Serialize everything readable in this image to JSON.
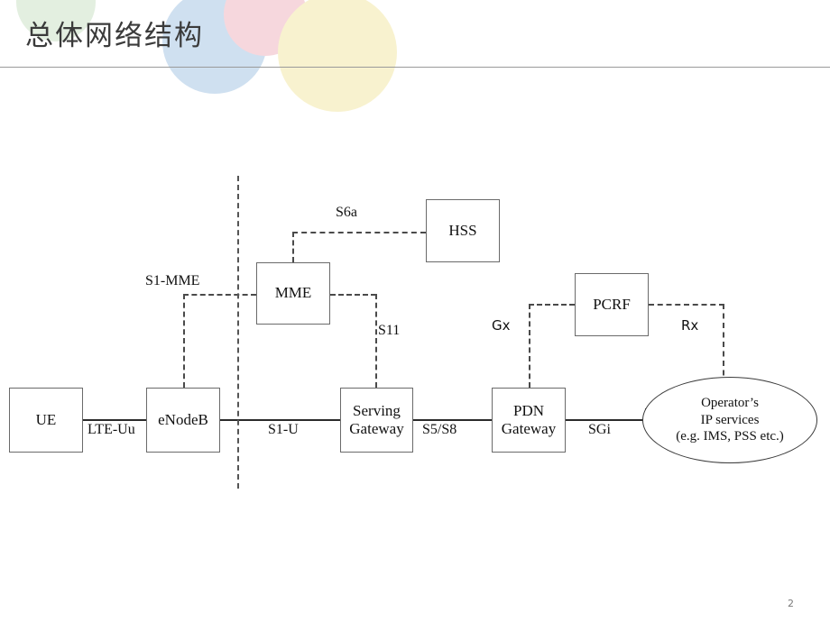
{
  "slide": {
    "title": "总体网络结构",
    "page_number": "2"
  },
  "decor": {
    "circle_green": "#e3efe0",
    "circle_blue": "#cfe0f0",
    "circle_pink": "#f6d7dd",
    "circle_yellow": "#f8f2cf",
    "rule_color": "#9a9a9a"
  },
  "diagram": {
    "type": "network-architecture",
    "nodes": [
      {
        "id": "ue",
        "label_line1": "UE",
        "label_line2": "",
        "shape": "rect"
      },
      {
        "id": "enodeb",
        "label_line1": "eNodeB",
        "label_line2": "",
        "shape": "rect"
      },
      {
        "id": "sgw",
        "label_line1": "Serving",
        "label_line2": "Gateway",
        "shape": "rect"
      },
      {
        "id": "pgw",
        "label_line1": "PDN",
        "label_line2": "Gateway",
        "shape": "rect"
      },
      {
        "id": "mme",
        "label_line1": "MME",
        "label_line2": "",
        "shape": "rect"
      },
      {
        "id": "hss",
        "label_line1": "HSS",
        "label_line2": "",
        "shape": "rect"
      },
      {
        "id": "pcrf",
        "label_line1": "PCRF",
        "label_line2": "",
        "shape": "rect"
      },
      {
        "id": "operator",
        "label_line1": "Operator’s",
        "label_line2": "IP services",
        "label_line3": "(e.g. IMS, PSS etc.)",
        "shape": "ellipse"
      }
    ],
    "interfaces": [
      {
        "id": "lte_uu",
        "label": "LTE-Uu",
        "from": "ue",
        "to": "enodeb",
        "style": "solid"
      },
      {
        "id": "s1_u",
        "label": "S1-U",
        "from": "enodeb",
        "to": "sgw",
        "style": "solid"
      },
      {
        "id": "s5_s8",
        "label": "S5/S8",
        "from": "sgw",
        "to": "pgw",
        "style": "solid"
      },
      {
        "id": "sgi",
        "label": "SGi",
        "from": "pgw",
        "to": "operator",
        "style": "solid"
      },
      {
        "id": "s1_mme",
        "label": "S1-MME",
        "from": "enodeb",
        "to": "mme",
        "style": "dashed"
      },
      {
        "id": "s6a",
        "label": "S6a",
        "from": "mme",
        "to": "hss",
        "style": "dashed"
      },
      {
        "id": "s11",
        "label": "S11",
        "from": "mme",
        "to": "sgw",
        "style": "dashed"
      },
      {
        "id": "gx",
        "label": "Gx",
        "from": "pcrf",
        "to": "pgw",
        "style": "dashed"
      },
      {
        "id": "rx",
        "label": "Rx",
        "from": "pcrf",
        "to": "operator",
        "style": "dashed"
      }
    ],
    "separator": {
      "id": "domain-separator",
      "style": "dashed-vertical"
    }
  }
}
